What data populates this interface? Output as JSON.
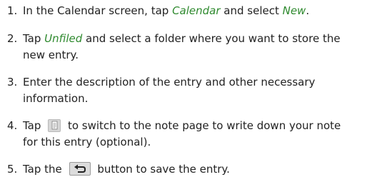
{
  "steps": [
    {
      "number": "1.",
      "t1": "In the Calendar screen, tap ",
      "k1": "Calendar",
      "t2": " and select ",
      "k2": "New",
      "t3": "."
    },
    {
      "number": "2.",
      "t1": "Tap ",
      "k1": "Unfiled",
      "t2": " and select a folder where you want to store the",
      "line2": "new entry."
    },
    {
      "number": "3.",
      "line1": "Enter the description of the entry and other necessary",
      "line2": "information."
    },
    {
      "number": "4.",
      "t1": "Tap ",
      "icon": "note-page-icon",
      "t2": " to switch to the note page to write down your note",
      "line2": "for this entry (optional)."
    },
    {
      "number": "5.",
      "t1": "Tap the ",
      "icon": "back-arrow-icon",
      "t2": " button to save the entry."
    }
  ],
  "colors": {
    "keyword": "#2f8a2f",
    "text": "#222222"
  }
}
